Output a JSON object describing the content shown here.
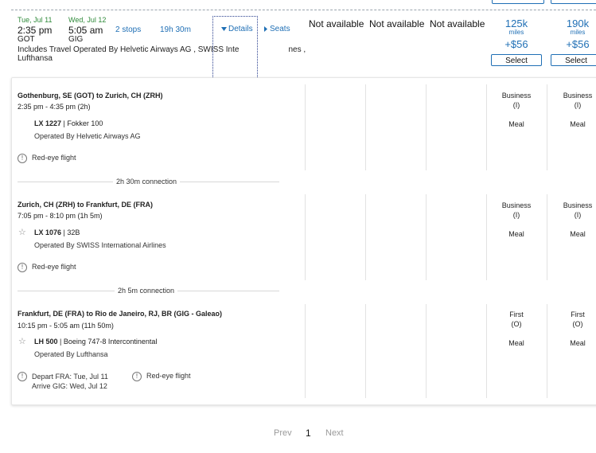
{
  "itinerary": {
    "depart_date": "Tue, Jul 11",
    "arrive_date": "Wed, Jul 12",
    "depart_time": "2:35 pm",
    "arrive_time": "5:05 am",
    "origin": "GOT",
    "destination": "GIG",
    "stops": "2 stops",
    "duration": "19h 30m",
    "details_label": "Details",
    "seats_label": "Seats",
    "operated_line1": "Includes Travel Operated By Helvetic Airways AG , SWISS Inte",
    "operated_line1_end": "nes ,",
    "operated_line2": "Lufthansa"
  },
  "fares": {
    "not_available": [
      "Not available",
      "Not available",
      "Not available"
    ],
    "options": [
      {
        "miles": "125k",
        "miles_unit": "miles",
        "price": "+$56",
        "select_label": "Select"
      },
      {
        "miles": "190k",
        "miles_unit": "miles",
        "price": "+$56",
        "select_label": "Select"
      }
    ]
  },
  "segments": [
    {
      "route": "Gothenburg, SE (GOT) to Zurich, CH (ZRH)",
      "time": "2:35 pm - 4:35 pm (2h)",
      "flight_no": "LX 1227",
      "aircraft": " | Fokker 100",
      "operator": "Operated By Helvetic Airways AG",
      "warnings": [
        "Red-eye flight"
      ],
      "cabins": [
        {
          "name": "Business",
          "code": "(I)",
          "meal": "Meal"
        },
        {
          "name": "Business",
          "code": "(I)",
          "meal": "Meal"
        }
      ]
    },
    {
      "route": "Zurich, CH (ZRH) to Frankfurt, DE (FRA)",
      "time": "7:05 pm - 8:10 pm (1h 5m)",
      "flight_no": "LX 1076",
      "aircraft": " | 32B",
      "operator": "Operated By SWISS International Airlines",
      "warnings": [
        "Red-eye flight"
      ],
      "cabins": [
        {
          "name": "Business",
          "code": "(I)",
          "meal": "Meal"
        },
        {
          "name": "Business",
          "code": "(I)",
          "meal": "Meal"
        }
      ]
    },
    {
      "route": "Frankfurt, DE (FRA) to Rio de Janeiro, RJ, BR (GIG - Galeao)",
      "time": "10:15 pm - 5:05 am (11h 50m)",
      "flight_no": "LH 500",
      "aircraft": " | Boeing 747-8 Intercontinental",
      "operator": "Operated By Lufthansa",
      "warning_depart": "Depart FRA: Tue, Jul 11",
      "warning_arrive": "Arrive GIG: Wed, Jul 12",
      "warnings": [
        "Red-eye flight"
      ],
      "cabins": [
        {
          "name": "First",
          "code": "(O)",
          "meal": "Meal"
        },
        {
          "name": "First",
          "code": "(O)",
          "meal": "Meal"
        }
      ]
    }
  ],
  "connections": [
    "2h 30m connection",
    "2h 5m connection"
  ],
  "pagination": {
    "prev": "Prev",
    "current": "1",
    "next": "Next"
  }
}
